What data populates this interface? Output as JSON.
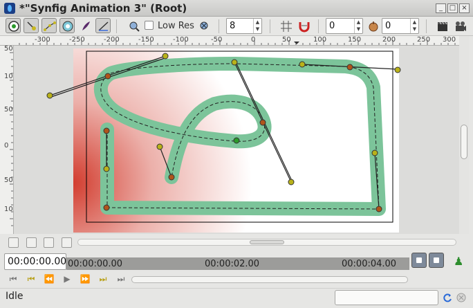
{
  "window": {
    "title": "*\"Synfig Animation 3\" (Root)"
  },
  "toolbar": {
    "tools": [
      "transform-tool",
      "smooth-move-tool",
      "spline-tool",
      "circle-tool",
      "feather-tool",
      "bline-tool"
    ],
    "low_res_label": "Low Res",
    "low_res_checked": false,
    "pixel_size_value": "8",
    "onion_past_value": "0",
    "onion_future_value": "0"
  },
  "ruler": {
    "top_labels": [
      "-300",
      "-250",
      "-200",
      "-150",
      "-100",
      "-50",
      "0",
      "50",
      "100",
      "150",
      "200",
      "250",
      "300"
    ],
    "left_labels": [
      "50",
      "100",
      "50",
      "0",
      "50",
      "100",
      "150"
    ]
  },
  "timebar": {
    "current_time": "00:00:00.00",
    "ticks": [
      "00:00:00.00",
      "00:00:02.00",
      "00:00:04.00"
    ]
  },
  "status": {
    "text": "Idle"
  },
  "colors": {
    "stroke": "#7cc49a",
    "gradient": "#d23c2e",
    "handle_yellow": "#b9b21a",
    "handle_orange": "#b0541a",
    "handle_green": "#2a9a2a"
  }
}
